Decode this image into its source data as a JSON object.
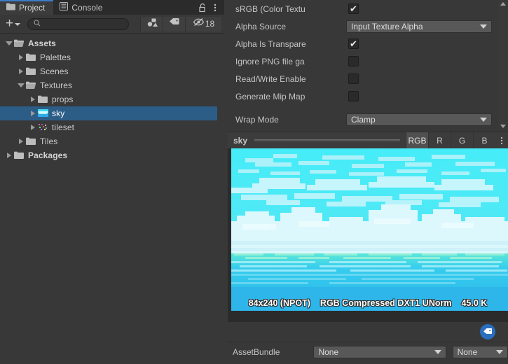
{
  "project_panel": {
    "tabs": [
      {
        "label": "Project",
        "icon": "folder-icon",
        "active": true
      },
      {
        "label": "Console",
        "icon": "console-icon",
        "active": false
      }
    ],
    "header_icons": [
      {
        "name": "lock-open-icon"
      },
      {
        "name": "kebab-menu-icon"
      }
    ],
    "toolbar": {
      "add_label": "+",
      "add_dropdown_icon": "chevron-down-icon",
      "search": {
        "value": "",
        "placeholder": "",
        "icon": "search-icon"
      },
      "buttons": [
        {
          "name": "filter-by-type-icon",
          "label": ""
        },
        {
          "name": "filter-by-label-icon",
          "label": ""
        },
        {
          "name": "hidden-count-icon",
          "label": "18"
        }
      ]
    },
    "tree": [
      {
        "label": "Assets",
        "depth": 0,
        "expanded": true,
        "icon": "folder-open-icon",
        "selected": false,
        "bold": true
      },
      {
        "label": "Palettes",
        "depth": 1,
        "expanded": false,
        "icon": "folder-icon",
        "selected": false,
        "bold": false
      },
      {
        "label": "Scenes",
        "depth": 1,
        "expanded": false,
        "icon": "folder-icon",
        "selected": false,
        "bold": false
      },
      {
        "label": "Textures",
        "depth": 1,
        "expanded": true,
        "icon": "folder-open-icon",
        "selected": false,
        "bold": false
      },
      {
        "label": "props",
        "depth": 2,
        "expanded": false,
        "icon": "folder-icon",
        "selected": false,
        "bold": false
      },
      {
        "label": "sky",
        "depth": 2,
        "expanded": false,
        "icon": "texture-sky-icon",
        "selected": true,
        "bold": false
      },
      {
        "label": "tileset",
        "depth": 2,
        "expanded": false,
        "icon": "texture-tileset-icon",
        "selected": false,
        "bold": false
      },
      {
        "label": "Tiles",
        "depth": 1,
        "expanded": false,
        "icon": "folder-icon",
        "selected": false,
        "bold": false
      },
      {
        "label": "Packages",
        "depth": 0,
        "expanded": false,
        "icon": "folder-icon",
        "selected": false,
        "bold": true
      }
    ]
  },
  "inspector": {
    "properties": [
      {
        "label": "sRGB (Color Textu",
        "type": "checkbox",
        "checked": true
      },
      {
        "label": "Alpha Source",
        "type": "dropdown",
        "value": "Input Texture Alpha"
      },
      {
        "label": "Alpha Is Transpare",
        "type": "checkbox",
        "checked": true
      },
      {
        "label": "Ignore PNG file ga",
        "type": "checkbox",
        "checked": false
      },
      {
        "label": "Read/Write Enable",
        "type": "checkbox",
        "checked": false
      },
      {
        "label": "Generate Mip Map",
        "type": "checkbox",
        "checked": false
      },
      {
        "label": "Wrap Mode",
        "type": "dropdown",
        "value": "Clamp"
      }
    ],
    "preview": {
      "name": "sky",
      "channel_buttons": [
        {
          "label": "RGB",
          "active": true
        },
        {
          "label": "R",
          "active": false
        },
        {
          "label": "G",
          "active": false
        },
        {
          "label": "B",
          "active": false
        }
      ],
      "menu_icon": "kebab-menu-icon",
      "info": [
        "84x240 (NPOT)",
        "RGB Compressed DXT1 UNorm",
        "45.0 K"
      ]
    },
    "tag_badge_icon": "label-tag-icon",
    "assetbundle": {
      "label": "AssetBundle",
      "name_value": "None",
      "variant_value": "None"
    },
    "scrollbar": {
      "up_icon": "scroll-up-arrow-icon",
      "down_icon": "scroll-down-arrow-icon"
    }
  },
  "colors": {
    "panel_bg": "#383838",
    "tab_bg": "#2b2b2b",
    "selection_blue": "#2c5d87",
    "accent_blue": "#3d7cc9",
    "badge_blue": "#2a6ec0",
    "sky_cyan": "#3fe8f5",
    "water_blue": "#29b6e8",
    "dropdown_bg": "#585858",
    "text": "#c4c4c4"
  }
}
